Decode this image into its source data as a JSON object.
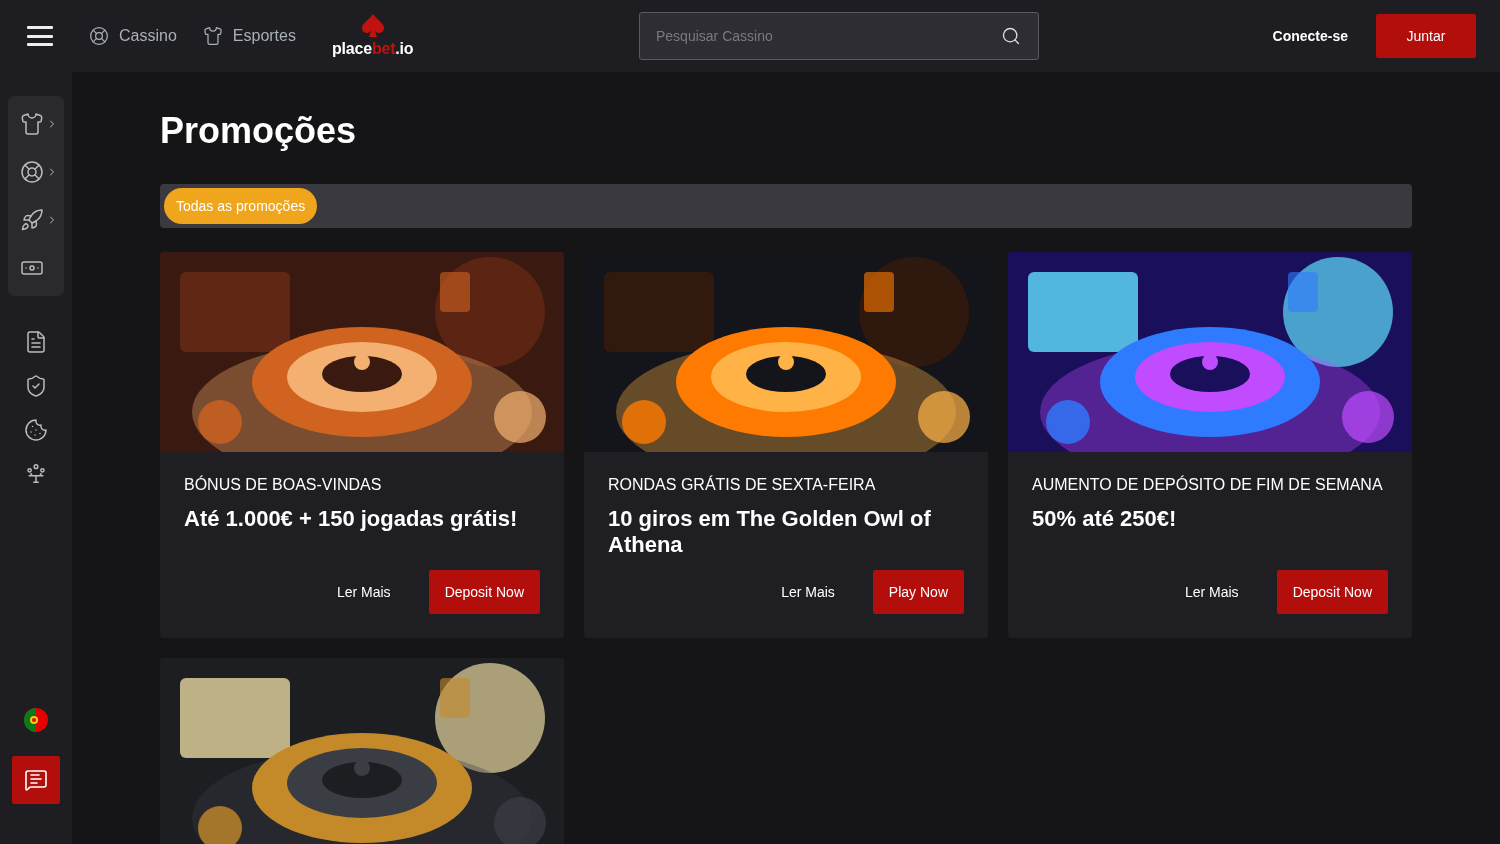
{
  "header": {
    "nav": [
      {
        "kind": "casino",
        "label": "Cassino"
      },
      {
        "kind": "sports",
        "label": "Esportes"
      }
    ],
    "logo": {
      "prefix": "place",
      "accent": "bet",
      "suffix": ".io"
    },
    "search": {
      "placeholder": "Pesquisar Cassino"
    },
    "login": "Conecte-se",
    "join": "Juntar"
  },
  "sidebar": {
    "group": [
      {
        "kind": "shirt",
        "expandable": true
      },
      {
        "kind": "lifebuoy",
        "expandable": true
      },
      {
        "kind": "rocket",
        "expandable": true
      },
      {
        "kind": "cash",
        "expandable": false
      }
    ],
    "links": [
      {
        "kind": "document"
      },
      {
        "kind": "shield"
      },
      {
        "kind": "cookie"
      },
      {
        "kind": "juggler"
      }
    ]
  },
  "page": {
    "title": "Promoções",
    "filters": [
      {
        "label": "Todas as promoções",
        "selected": true
      }
    ],
    "promotions": [
      {
        "category": "BÓNUS DE BOAS-VINDAS",
        "title": "Até 1.000€ + 150 jogadas grátis!",
        "more": "Ler Mais",
        "action": "Deposit Now"
      },
      {
        "category": "RONDAS GRÁTIS DE SEXTA-FEIRA",
        "title": "10 giros em The Golden Owl of Athena",
        "more": "Ler Mais",
        "action": "Play Now"
      },
      {
        "category": "AUMENTO DE DEPÓSITO DE FIM DE SEMANA",
        "title": "50% até 250€!",
        "more": "Ler Mais",
        "action": "Deposit Now"
      }
    ]
  }
}
